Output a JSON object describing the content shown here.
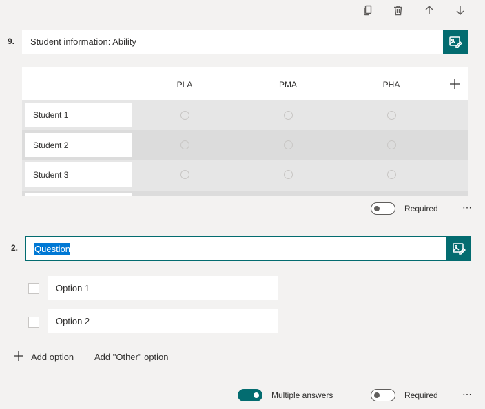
{
  "question9": {
    "number": "9.",
    "title": "Student information: Ability",
    "columns": [
      "PLA",
      "PMA",
      "PHA"
    ],
    "rows": [
      "Student 1",
      "Student 2",
      "Student 3"
    ],
    "required_label": "Required",
    "required_on": false
  },
  "question2": {
    "number": "2.",
    "title": "Question",
    "options": [
      "Option 1",
      "Option 2"
    ],
    "add_option_label": "Add option",
    "add_other_label": "Add \"Other\" option"
  },
  "footer": {
    "multiple_answers_label": "Multiple answers",
    "multiple_answers_on": true,
    "required_label": "Required",
    "required_on": false
  },
  "icons": {
    "toolbar": [
      "copy-icon",
      "delete-icon",
      "move-up-icon",
      "move-down-icon"
    ],
    "image": "insert-image-icon",
    "add": "plus-icon",
    "more": "more-options-icon"
  },
  "colors": {
    "accent": "#036c70",
    "selection": "#0078d4"
  }
}
